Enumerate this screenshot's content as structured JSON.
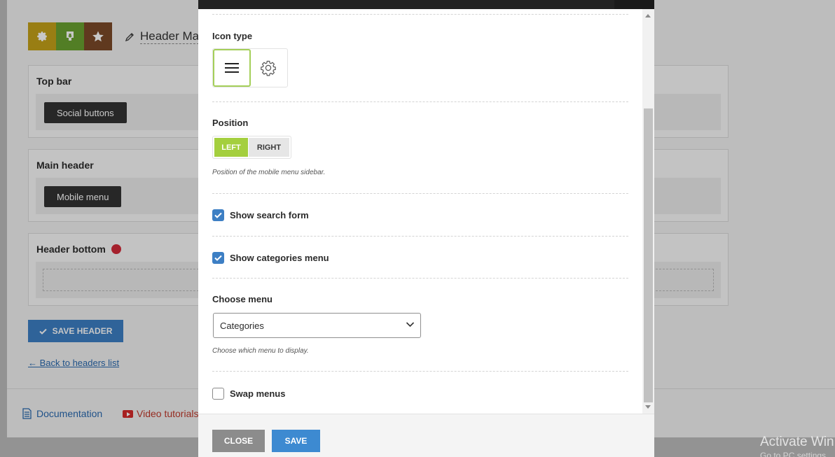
{
  "background": {
    "title": "Header Ma",
    "sections": [
      {
        "heading": "Top bar",
        "chip": "Social buttons"
      },
      {
        "heading": "Main header",
        "chip": "Mobile menu"
      },
      {
        "heading": "Header bottom"
      }
    ],
    "save_label": "SAVE HEADER",
    "back_link": "← Back to headers list",
    "documentation": "Documentation",
    "video_tutorials": "Video tutorials",
    "watermark": "Activate Win",
    "watermark_sub": "Go to PC settings"
  },
  "modal": {
    "icon_type": {
      "label": "Icon type",
      "options": [
        "hamburger-icon",
        "gear-icon"
      ],
      "selected": "hamburger-icon"
    },
    "position": {
      "label": "Position",
      "left": "LEFT",
      "right": "RIGHT",
      "selected": "LEFT",
      "hint": "Position of the mobile menu sidebar."
    },
    "show_search_form": {
      "label": "Show search form",
      "checked": true
    },
    "show_categories_menu": {
      "label": "Show categories menu",
      "checked": true
    },
    "choose_menu": {
      "label": "Choose menu",
      "value": "Categories",
      "hint": "Choose which menu to display."
    },
    "swap_menus": {
      "label": "Swap menus",
      "checked": false
    },
    "footer": {
      "close": "CLOSE",
      "save": "SAVE"
    }
  },
  "colors": {
    "accent_green": "#a4cf3e",
    "accent_blue": "#3d7fc4",
    "dark": "#222222"
  }
}
